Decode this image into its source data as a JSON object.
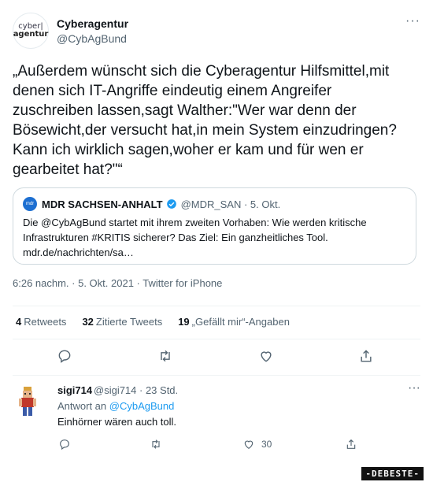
{
  "tweet": {
    "display_name": "Cyberagentur",
    "handle": "@CybAgBund",
    "logo_line1": "cyber|",
    "logo_line2": "agentur",
    "more": "···",
    "text": "„Außerdem wünscht sich die Cyberagentur Hilfsmittel,mit denen sich IT-Angriffe eindeutig einem Angreifer zuschreiben lassen,sagt Walther:\"Wer war denn der Bösewicht,der versucht hat,in mein System einzudringen? Kann ich wirklich sagen,woher er kam und für wen er gearbeitet hat?\"“",
    "timestamp": "6:26 nachm. · 5. Okt. 2021 · Twitter for iPhone"
  },
  "quote": {
    "avatar_text": "mdr",
    "name": "MDR SACHSEN-ANHALT",
    "meta": "@MDR_SAN · 5. Okt.",
    "text": "Die @CybAgBund startet mit ihrem zweiten Vorhaben: Wie werden kritische Infrastrukturen #KRITIS sicherer? Das Ziel: Ein ganzheitliches Tool. mdr.de/nachrichten/sa…"
  },
  "stats": {
    "retweets_count": "4",
    "retweets_label": "Retweets",
    "quotes_count": "32",
    "quotes_label": "Zitierte Tweets",
    "likes_count": "19",
    "likes_label": "„Gefällt mir“-Angaben"
  },
  "reply": {
    "name": "sigi714",
    "meta": "@sigi714 · 23 Std.",
    "reply_to_label": "Antwort an",
    "reply_to_handle": "@CybAgBund",
    "text": "Einhörner wären auch toll.",
    "like_count": "30",
    "more": "···"
  },
  "watermark": "-DEBESTE-",
  "colors": {
    "accent": "#1d9bf0",
    "muted": "#536471",
    "verified": "#1d9bf0"
  },
  "icons": [
    "reply-icon",
    "retweet-icon",
    "like-icon",
    "share-icon",
    "verified-icon"
  ]
}
